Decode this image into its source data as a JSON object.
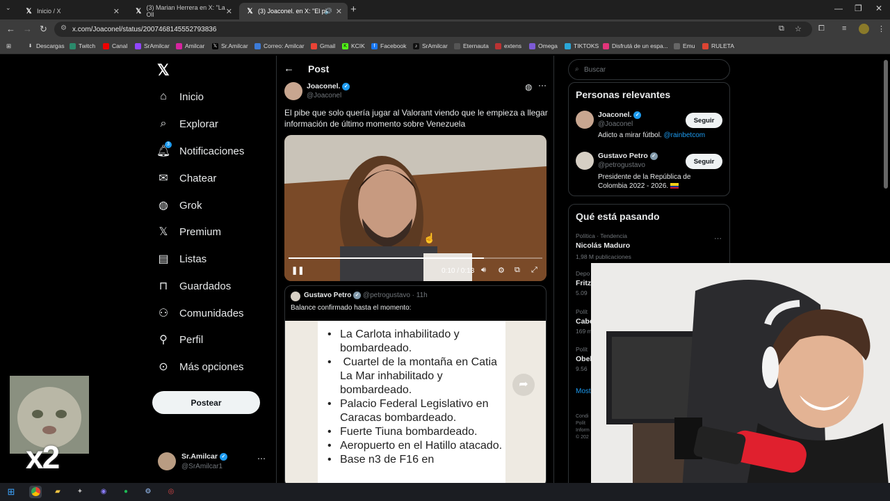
{
  "browser": {
    "tabs": [
      {
        "title": "Inicio / X",
        "active": false
      },
      {
        "title": "(3) Marian Herrera en X: \"La Oll",
        "active": false
      },
      {
        "title": "(3) Joaconel. en X: \"El pibe",
        "active": true
      }
    ],
    "url": "x.com/Joaconel/status/2007468145552793836",
    "bookmarks": [
      "Descargas",
      "Twitch",
      "Canal",
      "SrAmilcar",
      "Amilcar",
      "Sr.Amilcar",
      "Correo: Amilcar",
      "Gmail",
      "KCIK",
      "Facebook",
      "SrAmilcar",
      "Eternauta",
      "extens",
      "Omega",
      "TIKTOKS",
      "Disfrutá de un espa...",
      "Emu",
      "RULETA"
    ]
  },
  "sidebar": {
    "items": [
      {
        "label": "Inicio",
        "icon": "home-icon"
      },
      {
        "label": "Explorar",
        "icon": "search-icon"
      },
      {
        "label": "Notificaciones",
        "icon": "bell-icon",
        "badge": "3"
      },
      {
        "label": "Chatear",
        "icon": "mail-icon"
      },
      {
        "label": "Grok",
        "icon": "grok-icon"
      },
      {
        "label": "Premium",
        "icon": "x-premium-icon"
      },
      {
        "label": "Listas",
        "icon": "list-icon"
      },
      {
        "label": "Guardados",
        "icon": "bookmark-icon"
      },
      {
        "label": "Comunidades",
        "icon": "people-icon"
      },
      {
        "label": "Perfil",
        "icon": "person-icon"
      },
      {
        "label": "Más opciones",
        "icon": "more-circle-icon"
      }
    ],
    "post_button": "Postear",
    "account": {
      "name": "Sr.Amilcar",
      "handle": "@SrAmilcar1"
    }
  },
  "post": {
    "header_title": "Post",
    "author": {
      "name": "Joaconel.",
      "handle": "@Joaconel"
    },
    "text": "El pibe que solo quería jugar al Valorant viendo que le empieza a llegar información de último momento sobre Venezuela",
    "video": {
      "time": "0:10 / 0:13",
      "progress": 0.77
    },
    "quote": {
      "name": "Gustavo Petro",
      "handle": "@petrogustavo",
      "time": "· 11h",
      "text": "Balance confirmado hasta el momento:",
      "image_lines": [
        "La Carlota inhabilitado y bombardeado.",
        " Cuartel de la montaña en Catia La Mar inhabilitado y bombardeado.",
        "Palacio Federal Legislativo en Caracas bombardeado.",
        "Fuerte Tiuna bombardeado.",
        "Aeropuerto en el Hatillo atacado.",
        "Base n3 de F16 en"
      ]
    }
  },
  "right": {
    "search_placeholder": "Buscar",
    "relevant_title": "Personas relevantes",
    "people": [
      {
        "name": "Joaconel.",
        "handle": "@Joaconel",
        "bio": "Adicto a mirar fútbol. ",
        "bio_link": "@rainbetcom",
        "button": "Seguir"
      },
      {
        "name": "Gustavo Petro",
        "handle": "@petrogustavo",
        "bio": "Presidente de la República de Colombia 2022 - 2026.",
        "button": "Seguir"
      }
    ],
    "trending_title": "Qué está pasando",
    "trends": [
      {
        "meta": "Política · Tendencia",
        "name": "Nicolás Maduro",
        "count": "1,98 M publicaciones"
      },
      {
        "meta": "Depo",
        "name": "Fritz",
        "count": "5.09"
      },
      {
        "meta": "Polít",
        "name": "Cabe",
        "count": "169 m"
      },
      {
        "meta": "Polít",
        "name": "Obel",
        "count": "9.56"
      }
    ],
    "show_more": "Most",
    "footer": [
      "Condi",
      "Polít",
      "Inform",
      "© 202"
    ]
  },
  "overlay": {
    "multiplier": "x2"
  }
}
